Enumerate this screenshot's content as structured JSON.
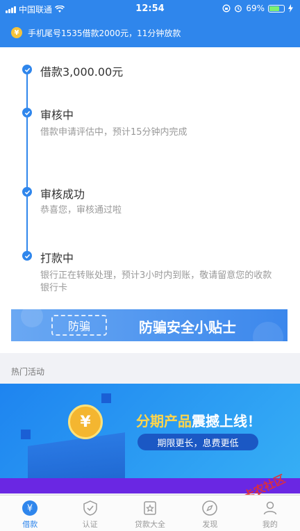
{
  "status_bar": {
    "carrier": "中国联通",
    "time": "12:54",
    "battery": "69%",
    "battery_level": 0.69
  },
  "notice": {
    "icon": "yen-coin-icon",
    "text": "手机尾号1535借款2000元，11分钟放款"
  },
  "timeline": [
    {
      "title": "借款3,000.00元",
      "desc": ""
    },
    {
      "title": "审核中",
      "desc": "借款申请评估中，预计15分钟内完成"
    },
    {
      "title": "审核成功",
      "desc": "恭喜您，审核通过啦"
    },
    {
      "title": "打款中",
      "desc": "银行正在转账处理，预计3小时内到账，敬请留意您的收款银行卡"
    }
  ],
  "tip_banner": {
    "tag": "防骗",
    "title": "防骗安全小贴士"
  },
  "section": {
    "label": "热门活动"
  },
  "promo": {
    "coin": "¥",
    "headline_hl": "分期产品",
    "headline_rest": "震撼上线！",
    "pill": "期限更长，息费更低"
  },
  "tabs": [
    {
      "label": "借款",
      "icon": "yen-coin-icon",
      "active": true
    },
    {
      "label": "认证",
      "icon": "shield-check-icon",
      "active": false
    },
    {
      "label": "贷款大全",
      "icon": "star-bag-icon",
      "active": false
    },
    {
      "label": "发现",
      "icon": "compass-icon",
      "active": false
    },
    {
      "label": "我的",
      "icon": "user-icon",
      "active": false
    }
  ],
  "watermark": "卡农社区",
  "colors": {
    "primary": "#2f86ec",
    "promo_highlight": "#ffd54a"
  }
}
